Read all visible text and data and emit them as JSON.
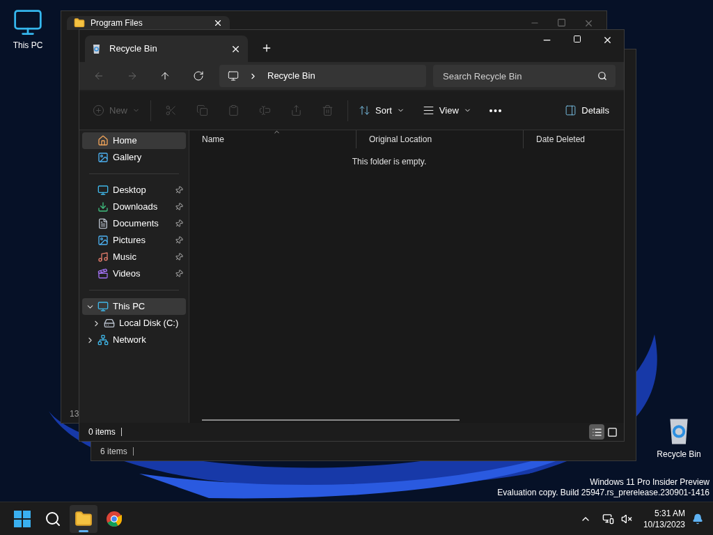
{
  "desktop_icons": [
    {
      "label": "This PC"
    },
    {
      "label": "Recycle Bin"
    }
  ],
  "back_window_1": {
    "tab_title": "Program Files",
    "column_1_text": "13"
  },
  "back_window_2": {
    "status": "6 items"
  },
  "window": {
    "tab_title": "Recycle Bin",
    "nav_buttons": [
      {
        "kind": "back",
        "disabled": true
      },
      {
        "kind": "forward",
        "disabled": true
      },
      {
        "kind": "up",
        "disabled": false
      },
      {
        "kind": "refresh",
        "disabled": false
      }
    ],
    "address": {
      "crumbs": [
        "Recycle Bin"
      ]
    },
    "search": {
      "placeholder": "Search Recycle Bin"
    },
    "toolbar": [
      {
        "kind": "new",
        "label": "New",
        "disabled": true
      },
      {
        "kind": "cut",
        "disabled": true
      },
      {
        "kind": "copy",
        "disabled": true
      },
      {
        "kind": "paste",
        "disabled": true
      },
      {
        "kind": "rename",
        "disabled": true
      },
      {
        "kind": "share",
        "disabled": true
      },
      {
        "kind": "delete",
        "disabled": true
      },
      {
        "kind": "sort",
        "label": "Sort",
        "disabled": false
      },
      {
        "kind": "view",
        "label": "View",
        "disabled": false
      },
      {
        "kind": "more",
        "disabled": false
      },
      {
        "kind": "details",
        "label": "Details",
        "disabled": false
      }
    ],
    "sidebar": {
      "quick": [
        {
          "label": "Home",
          "selected": true
        },
        {
          "label": "Gallery",
          "selected": false
        }
      ],
      "pinned": [
        {
          "label": "Desktop",
          "selected": false,
          "pinned": true
        },
        {
          "label": "Downloads",
          "selected": false,
          "pinned": true
        },
        {
          "label": "Documents",
          "selected": false,
          "pinned": true
        },
        {
          "label": "Pictures",
          "selected": false,
          "pinned": true
        },
        {
          "label": "Music",
          "selected": false,
          "pinned": true
        },
        {
          "label": "Videos",
          "selected": false,
          "pinned": true
        }
      ],
      "tree": [
        {
          "label": "This PC",
          "selected": true,
          "expanded": true,
          "children": [
            {
              "label": "Local Disk (C:)",
              "selected": false,
              "expanded": false
            }
          ]
        },
        {
          "label": "Network",
          "selected": false,
          "expanded": false
        }
      ]
    },
    "columns": [
      {
        "label": "Name",
        "sorted": true
      },
      {
        "label": "Original Location",
        "sorted": false
      },
      {
        "label": "Date Deleted",
        "sorted": false
      }
    ],
    "empty_message": "This folder is empty.",
    "status": "0 items",
    "view_buttons": [
      {
        "kind": "details",
        "selected": true
      },
      {
        "kind": "tiles",
        "selected": false
      }
    ]
  },
  "build_info": [
    "Windows 11 Pro Insider Preview",
    "Evaluation copy. Build 25947.rs_prerelease.230901-1416"
  ],
  "taskbar": {
    "apps": [
      {
        "kind": "start",
        "selected": false
      },
      {
        "kind": "search",
        "selected": false
      },
      {
        "kind": "explorer",
        "selected": true
      },
      {
        "kind": "chrome",
        "selected": false
      }
    ],
    "time": "5:31 AM",
    "date": "10/13/2023"
  }
}
